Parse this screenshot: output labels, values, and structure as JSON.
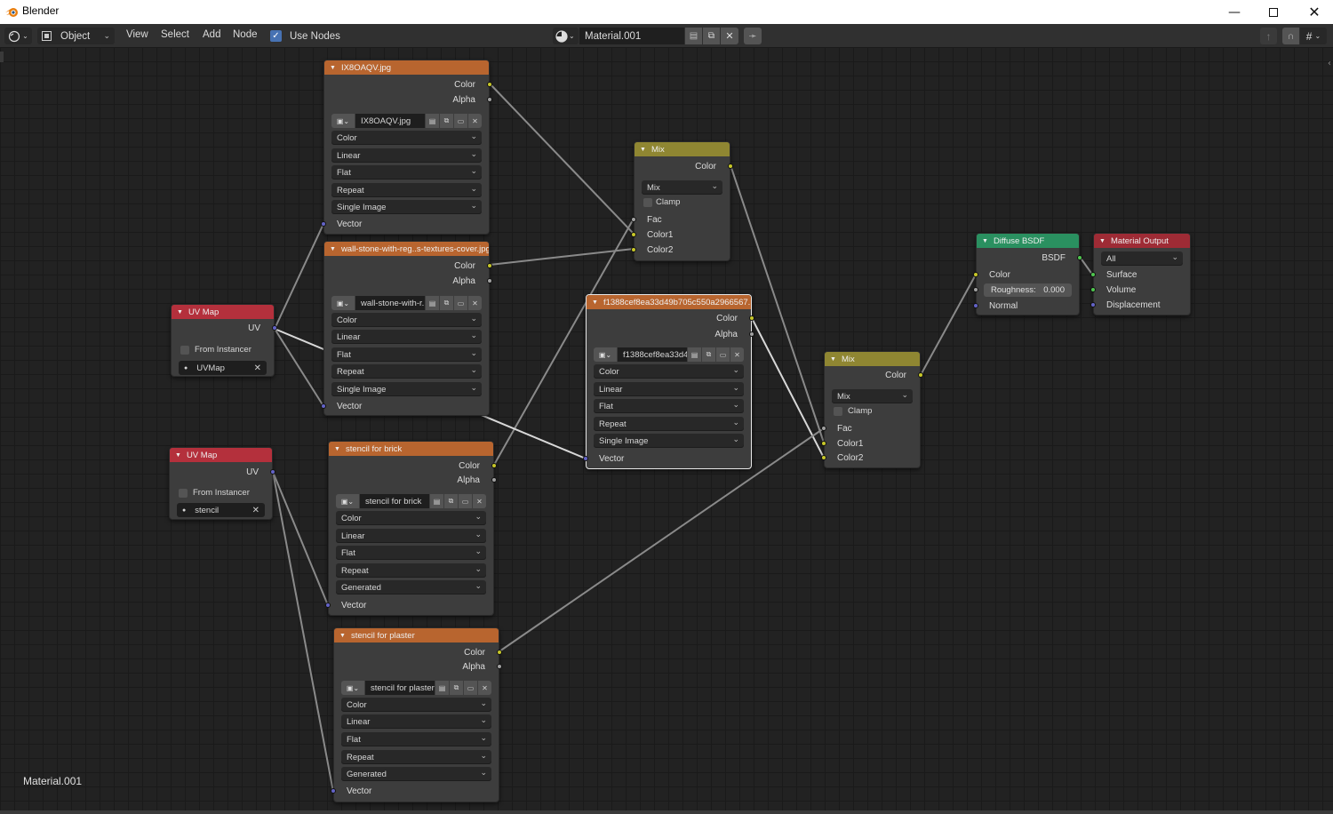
{
  "window": {
    "title": "Blender",
    "controls": [
      "minimize",
      "maximize",
      "close"
    ]
  },
  "header": {
    "editor_type_icon": "node-editor-icon",
    "mode": "Object",
    "menus": [
      "View",
      "Select",
      "Add",
      "Node"
    ],
    "use_nodes": {
      "label": "Use Nodes",
      "checked": true
    },
    "material": {
      "browse_icon": "material-sphere-icon",
      "name": "Material.001",
      "buttons": [
        "fake-user-icon",
        "duplicate-icon",
        "unlink-icon"
      ],
      "pin_icon": "pin-icon"
    },
    "right_tools": [
      "parent-node-tree-icon",
      "snap-magnet-icon",
      "snap-grid-icon"
    ]
  },
  "canvas": {
    "material_label": "Material.001"
  },
  "colors": {
    "texture_header": "#b8652f",
    "mix_header": "#8f8632",
    "uv_header": "#b4303c",
    "shader_header": "#2a9060",
    "output_header": "#9e2b35",
    "socket_color": "#c7c729",
    "socket_float": "#a1a1a1",
    "socket_vector": "#6363c7",
    "socket_shader": "#4fc64f"
  },
  "nodes": {
    "tex1": {
      "title": "IX8OAQV.jpg",
      "outputs": [
        "Color",
        "Alpha"
      ],
      "image_name": "IX8OAQV.jpg",
      "color_space": "Color",
      "interpolation": "Linear",
      "projection": "Flat",
      "extension": "Repeat",
      "source": "Single Image",
      "input": "Vector"
    },
    "tex2": {
      "title": "wall-stone-with-reg..s-textures-cover.jpg",
      "outputs": [
        "Color",
        "Alpha"
      ],
      "image_name": "wall-stone-with-r..",
      "color_space": "Color",
      "interpolation": "Linear",
      "projection": "Flat",
      "extension": "Repeat",
      "source": "Single Image",
      "input": "Vector"
    },
    "tex3": {
      "title": "f1388cef8ea33d49b705c550a2966567...",
      "outputs": [
        "Color",
        "Alpha"
      ],
      "image_name": "f1388cef8ea33d4..",
      "color_space": "Color",
      "interpolation": "Linear",
      "projection": "Flat",
      "extension": "Repeat",
      "source": "Single Image",
      "input": "Vector"
    },
    "tex4": {
      "title": "stencil for brick",
      "outputs": [
        "Color",
        "Alpha"
      ],
      "image_name": "stencil for brick",
      "color_space": "Color",
      "interpolation": "Linear",
      "projection": "Flat",
      "extension": "Repeat",
      "source": "Generated",
      "input": "Vector"
    },
    "tex5": {
      "title": "stencil for plaster",
      "outputs": [
        "Color",
        "Alpha"
      ],
      "image_name": "stencil for plaster",
      "color_space": "Color",
      "interpolation": "Linear",
      "projection": "Flat",
      "extension": "Repeat",
      "source": "Generated",
      "input": "Vector"
    },
    "uv1": {
      "title": "UV Map",
      "output": "UV",
      "from_instancer": "From Instancer",
      "uv_map": "UVMap"
    },
    "uv2": {
      "title": "UV Map",
      "output": "UV",
      "from_instancer": "From Instancer",
      "uv_map": "stencil"
    },
    "mix1": {
      "title": "Mix",
      "output": "Color",
      "blend_type": "Mix",
      "clamp": "Clamp",
      "inputs": [
        "Fac",
        "Color1",
        "Color2"
      ]
    },
    "mix2": {
      "title": "Mix",
      "output": "Color",
      "blend_type": "Mix",
      "clamp": "Clamp",
      "inputs": [
        "Fac",
        "Color1",
        "Color2"
      ]
    },
    "diffuse": {
      "title": "Diffuse BSDF",
      "output": "BSDF",
      "color_input": "Color",
      "roughness_label": "Roughness:",
      "roughness_value": "0.000",
      "normal_input": "Normal"
    },
    "output": {
      "title": "Material Output",
      "target": "All",
      "inputs": [
        "Surface",
        "Volume",
        "Displacement"
      ]
    }
  },
  "links": [
    {
      "from": "tex1.Color",
      "to": "mix1.Color1"
    },
    {
      "from": "tex2.Color",
      "to": "mix1.Color2"
    },
    {
      "from": "tex4.Color",
      "to": "mix1.Fac"
    },
    {
      "from": "mix1.Color",
      "to": "mix2.Color1"
    },
    {
      "from": "tex3.Color",
      "to": "mix2.Color2"
    },
    {
      "from": "tex5.Color",
      "to": "mix2.Fac"
    },
    {
      "from": "mix2.Color",
      "to": "diffuse.Color"
    },
    {
      "from": "diffuse.BSDF",
      "to": "output.Surface"
    },
    {
      "from": "uv1.UV",
      "to": "tex1.Vector"
    },
    {
      "from": "uv1.UV",
      "to": "tex2.Vector"
    },
    {
      "from": "uv1.UV",
      "to": "tex3.Vector"
    },
    {
      "from": "uv2.UV",
      "to": "tex4.Vector"
    },
    {
      "from": "uv2.UV",
      "to": "tex5.Vector"
    }
  ]
}
